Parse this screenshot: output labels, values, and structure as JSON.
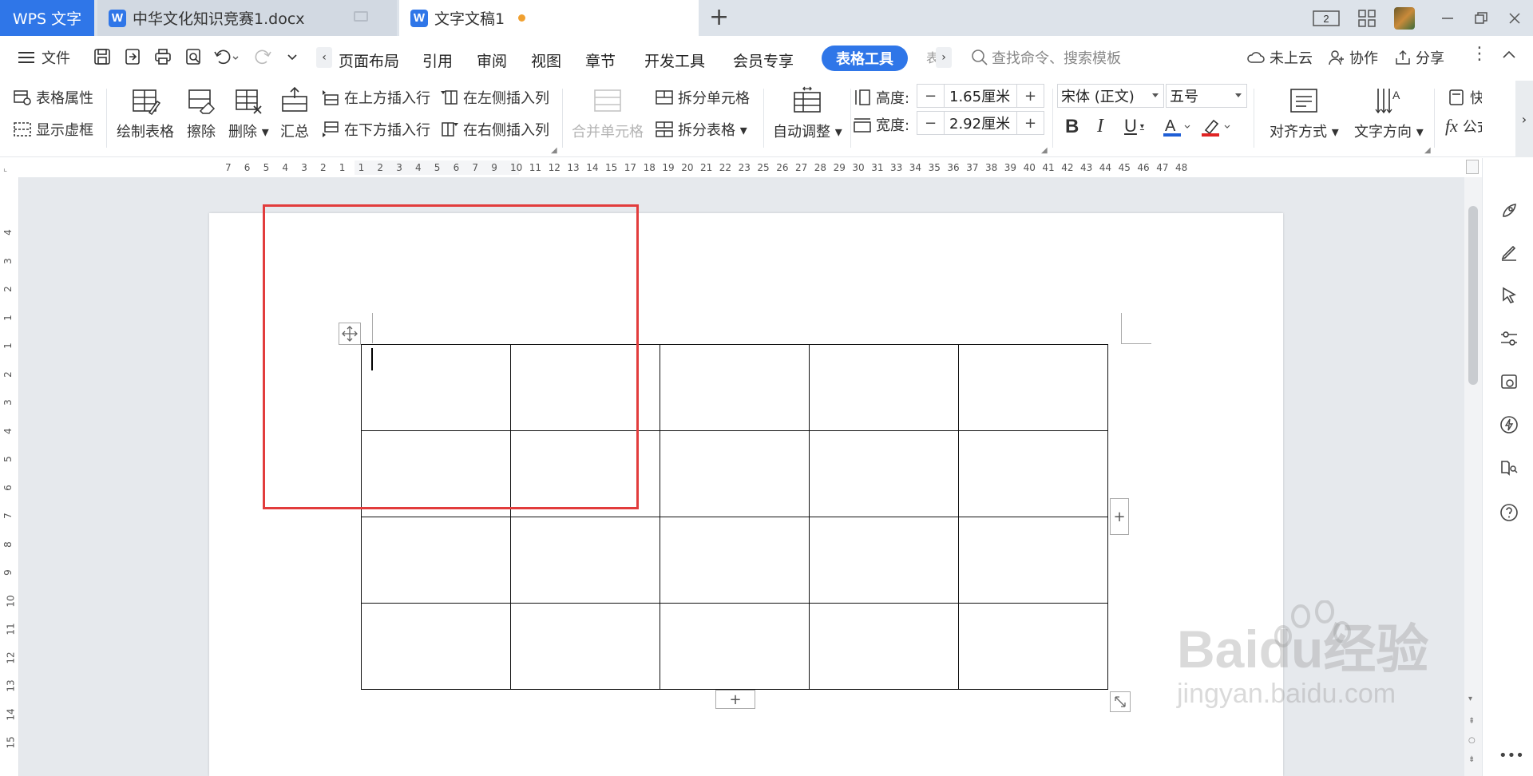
{
  "app": {
    "brand": "WPS 文字",
    "tabs": [
      {
        "label": "中华文化知识竞赛1.docx",
        "active": false
      },
      {
        "label": "文字文稿1",
        "active": true,
        "unsaved": true
      }
    ],
    "window_badge": "2"
  },
  "menu": {
    "file_label": "文件",
    "items": [
      "页面布局",
      "引用",
      "审阅",
      "视图",
      "章节",
      "开发工具",
      "会员专享"
    ],
    "active_tab": "表格工具",
    "search_placeholder": "查找命令、搜索模板",
    "cloud_status": "未上云",
    "collab": "协作",
    "share": "分享"
  },
  "ribbon": {
    "table_props": "表格属性",
    "show_gridlines": "显示虚框",
    "draw_table": "绘制表格",
    "erase": "擦除",
    "delete": "删除",
    "summary": "汇总",
    "insert_above": "在上方插入行",
    "insert_below": "在下方插入行",
    "insert_left": "在左侧插入列",
    "insert_right": "在右侧插入列",
    "merge_cells": "合并单元格",
    "split_cells": "拆分单元格",
    "split_table": "拆分表格",
    "auto_fit": "自动调整",
    "height_label": "高度:",
    "height_value": "1.65厘米",
    "width_label": "宽度:",
    "width_value": "2.92厘米",
    "font_name": "宋体 (正文)",
    "font_size": "五号",
    "align": "对齐方式",
    "text_direction": "文字方向",
    "quick_calc": "快速计算",
    "formula": "公式"
  },
  "ruler": {
    "h_ticks": [
      "7",
      "6",
      "5",
      "4",
      "3",
      "2",
      "1",
      "1",
      "2",
      "3",
      "4",
      "5",
      "6",
      "7",
      "9",
      "10",
      "11",
      "12",
      "13",
      "14",
      "15",
      "17",
      "18",
      "19",
      "20",
      "21",
      "22",
      "23",
      "25",
      "26",
      "27",
      "28",
      "29",
      "30",
      "31",
      "33",
      "34",
      "35",
      "36",
      "37",
      "38",
      "39",
      "40",
      "41",
      "42",
      "43",
      "44",
      "45",
      "46",
      "47",
      "48"
    ],
    "v_ticks": [
      "4",
      "3",
      "2",
      "1",
      "1",
      "2",
      "3",
      "4",
      "5",
      "6",
      "7",
      "8",
      "9",
      "10",
      "11",
      "12",
      "13",
      "14",
      "15"
    ]
  },
  "table": {
    "rows": 4,
    "cols": 5
  },
  "watermark": {
    "line1": "Baidu经验",
    "line2": "jingyan.baidu.com"
  },
  "colors": {
    "accent": "#2f76e8",
    "highlight_box": "#e23c3c"
  }
}
